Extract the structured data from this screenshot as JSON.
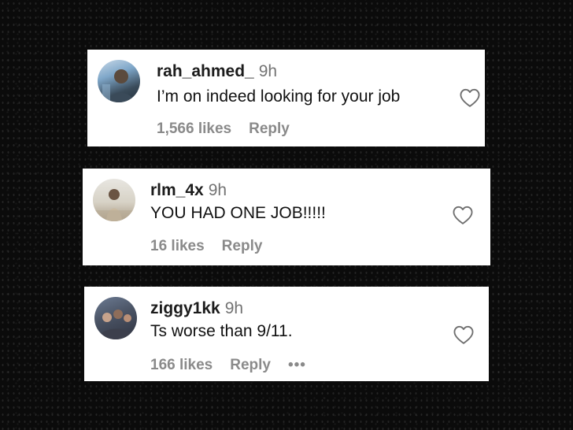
{
  "comments": [
    {
      "username": "rah_ahmed_",
      "time": "9h",
      "text": "I’m on indeed looking for your job",
      "likes": "1,566 likes",
      "reply_label": "Reply",
      "more_label": ""
    },
    {
      "username": "rlm_4x",
      "time": "9h",
      "text": "YOU HAD ONE JOB!!!!!",
      "likes": "16 likes",
      "reply_label": "Reply",
      "more_label": ""
    },
    {
      "username": "ziggy1kk",
      "time": "9h",
      "text": "Ts worse than 9/11.",
      "likes": "166 likes",
      "reply_label": "Reply",
      "more_label": "•••"
    }
  ],
  "icons": {
    "like": "heart-outline-icon",
    "more": "more-options-icon"
  },
  "colors": {
    "background": "#0b0b0b",
    "card": "#ffffff",
    "username": "#1c1c1c",
    "secondary": "#737373",
    "meta": "#8a8a8a"
  }
}
